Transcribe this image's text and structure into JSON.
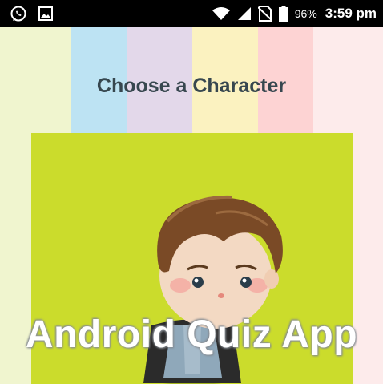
{
  "status_bar": {
    "battery_percent": "96%",
    "time": "3:59 pm",
    "icons": [
      "whatsapp-icon",
      "gallery-icon",
      "wifi-icon",
      "signal-icon",
      "no-sim-icon",
      "battery-icon"
    ]
  },
  "background": {
    "stripes": [
      "#f0f5cf",
      "#bde3f3",
      "#e3d8ea",
      "#fbf2c0",
      "#fdd3d3",
      "#fdebeb"
    ]
  },
  "screen": {
    "heading": "Choose a Character"
  },
  "card": {
    "background": "#cbdc2c",
    "overlay_title": "Android Quiz App"
  }
}
